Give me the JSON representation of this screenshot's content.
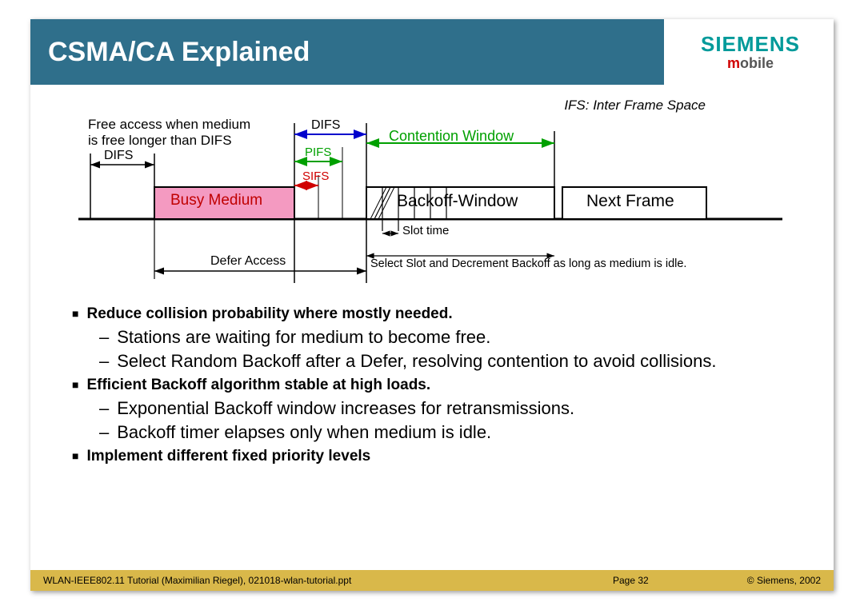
{
  "header": {
    "title": "CSMA/CA Explained",
    "brand1": "SIEMENS",
    "brand2a": "m",
    "brand2b": "obile"
  },
  "diagram": {
    "ifs_note": "IFS: Inter Frame Space",
    "free_access1": "Free access when medium",
    "free_access2": "is free longer than DIFS",
    "difs_top": "DIFS",
    "pifs": "PIFS",
    "sifs": "SIFS",
    "difs_left": "DIFS",
    "busy": "Busy Medium",
    "backoff": "Backoff-Window",
    "next": "Next Frame",
    "contention": "Contention Window",
    "slot": "Slot time",
    "defer": "Defer Access",
    "select_note": "Select Slot and Decrement Backoff as long as medium is idle."
  },
  "content": {
    "b1": "Reduce collision probability where mostly needed.",
    "b1a": "Stations are waiting for medium to become free.",
    "b1b": "Select Random Backoff after a Defer, resolving contention to avoid collisions.",
    "b2": "Efficient Backoff algorithm stable at high loads.",
    "b2a": "Exponential Backoff window increases for retransmissions.",
    "b2b": "Backoff timer elapses only when medium is idle.",
    "b3": "Implement different fixed priority levels"
  },
  "footer": {
    "left": "WLAN-IEEE802.11 Tutorial (Maximilian Riegel), 021018-wlan-tutorial.ppt",
    "center": "Page 32",
    "right": "© Siemens, 2002"
  }
}
